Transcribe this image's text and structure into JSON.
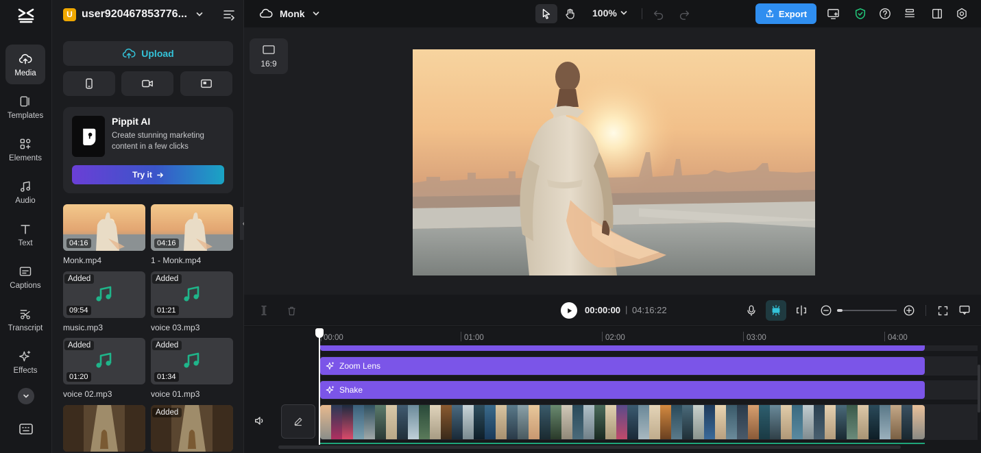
{
  "app": {
    "accent": "#34c3d9",
    "export_color": "#2f8ef0"
  },
  "nav": {
    "items": [
      {
        "label": "Media",
        "icon": "cloud-upload-icon"
      },
      {
        "label": "Templates",
        "icon": "template-icon"
      },
      {
        "label": "Elements",
        "icon": "elements-icon"
      },
      {
        "label": "Audio",
        "icon": "music-note-icon"
      },
      {
        "label": "Text",
        "icon": "text-t-icon"
      },
      {
        "label": "Captions",
        "icon": "captions-icon"
      },
      {
        "label": "Transcript",
        "icon": "transcript-icon"
      },
      {
        "label": "Effects",
        "icon": "sparkle-icon"
      }
    ]
  },
  "panel": {
    "avatar_letter": "U",
    "username": "user920467853776...",
    "upload_label": "Upload",
    "promo": {
      "title": "Pippit AI",
      "description": "Create stunning marketing content in a few clicks",
      "cta": "Try it"
    },
    "media": [
      {
        "name": "Monk.mp4",
        "duration": "04:16",
        "type": "video",
        "added": ""
      },
      {
        "name": "1 - Monk.mp4",
        "duration": "04:16",
        "type": "video",
        "added": ""
      },
      {
        "name": "music.mp3",
        "duration": "09:54",
        "type": "audio",
        "added": "Added"
      },
      {
        "name": "voice 03.mp3",
        "duration": "01:21",
        "type": "audio",
        "added": "Added"
      },
      {
        "name": "voice 02.mp3",
        "duration": "01:20",
        "type": "audio",
        "added": "Added"
      },
      {
        "name": "voice 01.mp3",
        "duration": "01:34",
        "type": "audio",
        "added": "Added"
      },
      {
        "name": "",
        "duration": "",
        "type": "image",
        "added": ""
      },
      {
        "name": "",
        "duration": "",
        "type": "image",
        "added": "Added"
      }
    ]
  },
  "toolbar": {
    "project_name": "Monk",
    "zoom": "100%",
    "export_label": "Export"
  },
  "preview": {
    "aspect_ratio": "16:9"
  },
  "playback": {
    "current_time": "00:00:00",
    "separator": "|",
    "total_time": "04:16:22"
  },
  "timeline": {
    "ticks": [
      "00:00",
      "01:00",
      "02:00",
      "03:00",
      "04:00"
    ],
    "effects": [
      "Zoom Lens",
      "Shake"
    ]
  }
}
